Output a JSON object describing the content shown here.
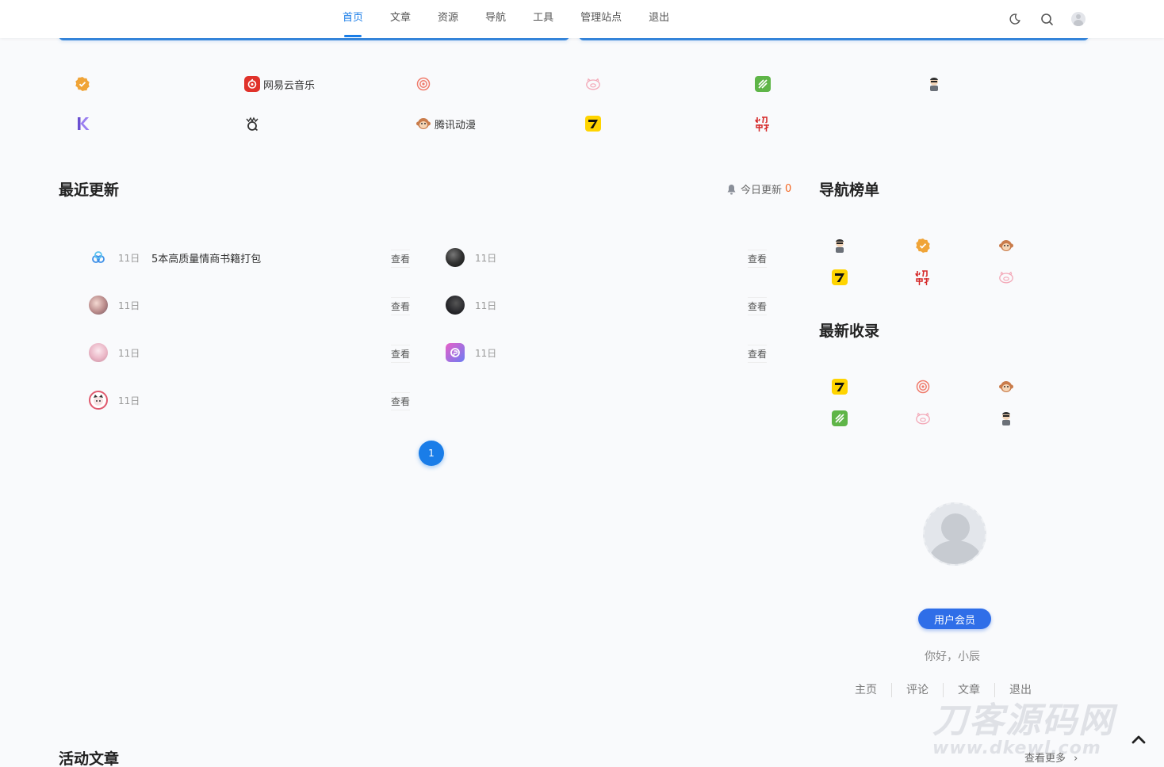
{
  "nav": {
    "items": [
      {
        "label": "首页",
        "active": true
      },
      {
        "label": "文章",
        "active": false
      },
      {
        "label": "资源",
        "active": false
      },
      {
        "label": "导航",
        "active": false
      },
      {
        "label": "工具",
        "active": false
      },
      {
        "label": "管理站点",
        "active": false
      },
      {
        "label": "退出",
        "active": false
      }
    ],
    "tools": [
      "moon-icon",
      "search-icon",
      "avatar"
    ]
  },
  "links": {
    "row1": [
      {
        "icon": "verified-badge-icon",
        "label": ""
      },
      {
        "icon": "netease-music-icon",
        "label": "网易云音乐"
      },
      {
        "icon": "target-icon",
        "label": ""
      },
      {
        "icon": "pig-icon",
        "label": ""
      },
      {
        "icon": "green-leaf-icon",
        "label": ""
      },
      {
        "icon": "cartoon-man-icon",
        "label": ""
      }
    ],
    "row2": [
      {
        "icon": "k-logo-icon",
        "label": ""
      },
      {
        "icon": "q-logo-icon",
        "label": ""
      },
      {
        "icon": "monkey-icon",
        "label": "腾讯动漫"
      },
      {
        "icon": "seven-cat-icon",
        "label": ""
      },
      {
        "icon": "xiaodao-yule-icon",
        "label": ""
      }
    ]
  },
  "recent": {
    "title": "最近更新",
    "today_label": "今日更新",
    "today_count": "0",
    "view_label": "查看",
    "left": [
      {
        "thumb": "baidu-cloud-thumb",
        "date": "11日",
        "title": "5本高质量情商书籍打包"
      },
      {
        "thumb": "anime-girl-thumb",
        "date": "11日",
        "title": ""
      },
      {
        "thumb": "anime-pink-thumb",
        "date": "11日",
        "title": ""
      },
      {
        "thumb": "anime-cat-thumb",
        "date": "11日",
        "title": ""
      }
    ],
    "right": [
      {
        "thumb": "dark-photo-thumb",
        "date": "11日",
        "title": ""
      },
      {
        "thumb": "dark-figure-thumb",
        "date": "11日",
        "title": ""
      },
      {
        "thumb": "purple-app-thumb",
        "date": "11日",
        "title": ""
      }
    ],
    "page": "1"
  },
  "nav_rank": {
    "title": "导航榜单",
    "items": [
      "cartoon-man-icon",
      "verified-badge-icon",
      "monkey-icon",
      "seven-cat-icon",
      "xiaodao-yule-icon",
      "pig-icon"
    ]
  },
  "newest": {
    "title": "最新收录",
    "items": [
      "seven-cat-icon",
      "target-icon",
      "monkey-icon",
      "green-leaf-icon",
      "pig-icon",
      "cartoon-man-icon"
    ]
  },
  "user": {
    "member_label": "用户会员",
    "greeting": "你好，小辰",
    "links": [
      "主页",
      "评论",
      "文章",
      "退出"
    ]
  },
  "active_articles": {
    "title": "活动文章",
    "more_label": "查看更多"
  },
  "watermark": {
    "line1": "刀客源码网",
    "line2": "www.dkewl.com"
  },
  "colors": {
    "accent": "#1a7de8",
    "orange": "#f4651f",
    "member": "#2f6ee8"
  }
}
